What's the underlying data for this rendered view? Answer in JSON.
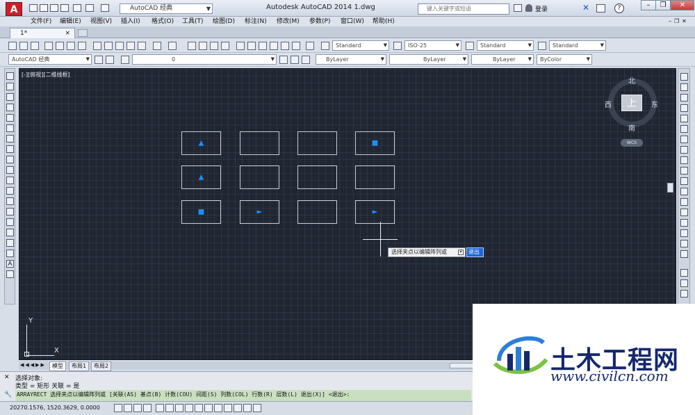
{
  "titlebar": {
    "logo": "A",
    "workspace": "AutoCAD 经典",
    "app_title": "Autodesk AutoCAD 2014    1.dwg",
    "search_placeholder": "键入关键字或短语",
    "login": "登录"
  },
  "menu": [
    "文件(F)",
    "编辑(E)",
    "视图(V)",
    "插入(I)",
    "格式(O)",
    "工具(T)",
    "绘图(D)",
    "标注(N)",
    "修改(M)",
    "参数(P)",
    "窗口(W)",
    "帮助(H)"
  ],
  "doc_tab": {
    "label": "1*",
    "close": "×"
  },
  "toolbar1": {
    "text_style": "Standard",
    "dim_style": "ISO-25",
    "table_style": "Standard",
    "mleader_style": "Standard"
  },
  "toolbar2": {
    "workspace": "AutoCAD 经典",
    "layer": "0",
    "color": "ByLayer",
    "linetype": "ByLayer",
    "lineweight": "ByLayer",
    "plotstyle": "ByColor"
  },
  "viewport": {
    "label": "[-][俯视][二维线框]"
  },
  "viewcube": {
    "north": "北",
    "south": "南",
    "east": "东",
    "west": "西",
    "face": "上",
    "wcs": "WCS"
  },
  "ucs": {
    "x": "X",
    "y": "Y"
  },
  "array_grid": [
    [
      "▲",
      "",
      "",
      "■"
    ],
    [
      "▲",
      "",
      "",
      ""
    ],
    [
      "■",
      "►",
      "",
      "►"
    ]
  ],
  "tooltip": {
    "prompt": "选择夹点以编辑阵列或",
    "option": "退出"
  },
  "layout_tabs": [
    "模型",
    "布局1",
    "布局2"
  ],
  "command": {
    "history1": "选择对象:",
    "history2": "类型 = 矩形  关联 = 是",
    "input": "ARRAYRECT 选择夹点以编辑阵列或 [关联(AS) 基点(B) 计数(COU) 间距(S) 列数(COL) 行数(R) 层数(L) 退出(X)] <退出>:"
  },
  "status": {
    "coords": "20270.1576, 1520.3629, 0.0000"
  },
  "watermark": {
    "title": "土木工程网",
    "url": "www.civilcn.com"
  },
  "colors": {
    "canvas": "#212633",
    "accent": "#1e8fff",
    "watermark": "#14286e"
  }
}
